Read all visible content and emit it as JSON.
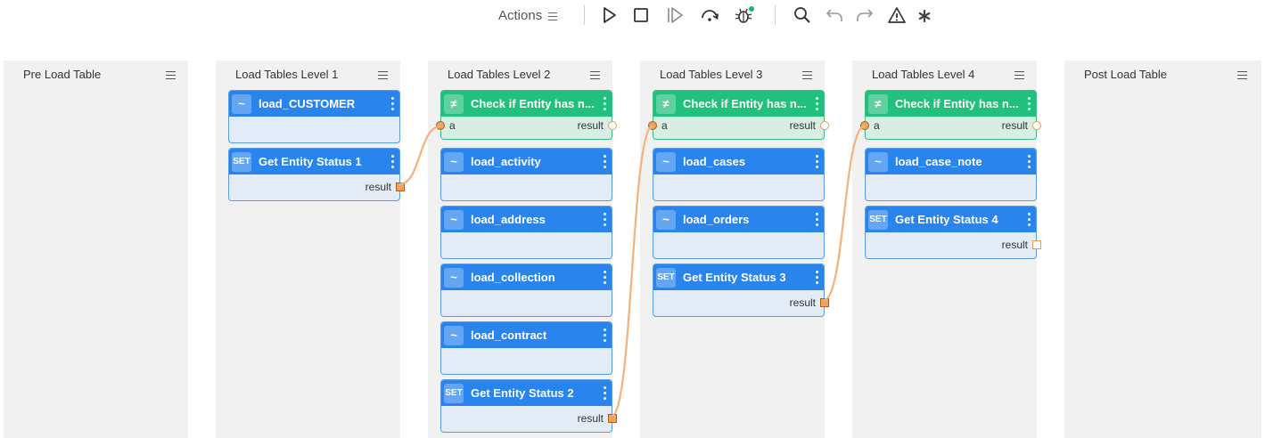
{
  "toolbar": {
    "actions_label": "Actions",
    "buttons": [
      "play-icon",
      "stop-icon",
      "step-icon",
      "step-over-icon",
      "bug-icon",
      "search-icon",
      "undo-icon",
      "redo-icon",
      "warning-icon",
      "asterisk-icon"
    ],
    "accent_color": "#2a84ee",
    "debug_indicator_color": "#1bb36b"
  },
  "columns": [
    {
      "title": "Pre Load Table"
    },
    {
      "title": "Load Tables Level 1"
    },
    {
      "title": "Load Tables Level 2"
    },
    {
      "title": "Load Tables Level 3"
    },
    {
      "title": "Load Tables Level 4"
    },
    {
      "title": "Post Load Table"
    }
  ],
  "cards": {
    "l1_load_customer": {
      "icon": "~",
      "title": "load_CUSTOMER"
    },
    "l1_get_status": {
      "icon": "SET",
      "title": "Get Entity Status 1",
      "output": "result"
    },
    "l2_check": {
      "icon": "≠",
      "title": "Check if Entity has n...",
      "input": "a",
      "output": "result"
    },
    "l2_load_activity": {
      "icon": "~",
      "title": "load_activity"
    },
    "l2_load_address": {
      "icon": "~",
      "title": "load_address"
    },
    "l2_load_collection": {
      "icon": "~",
      "title": "load_collection"
    },
    "l2_load_contract": {
      "icon": "~",
      "title": "load_contract"
    },
    "l2_get_status": {
      "icon": "SET",
      "title": "Get Entity Status 2",
      "output": "result"
    },
    "l3_check": {
      "icon": "≠",
      "title": "Check if Entity has n...",
      "input": "a",
      "output": "result"
    },
    "l3_load_cases": {
      "icon": "~",
      "title": "load_cases"
    },
    "l3_load_orders": {
      "icon": "~",
      "title": "load_orders"
    },
    "l3_get_status": {
      "icon": "SET",
      "title": "Get Entity Status 3",
      "output": "result"
    },
    "l4_check": {
      "icon": "≠",
      "title": "Check if Entity has n...",
      "input": "a",
      "output": "result"
    },
    "l4_load_case_note": {
      "icon": "~",
      "title": "load_case_note"
    },
    "l4_get_status": {
      "icon": "SET",
      "title": "Get Entity Status 4",
      "output": "result"
    }
  },
  "colors": {
    "task_header": "#2a84ee",
    "condition_header": "#22c07d",
    "wire": "#f2b27a",
    "column_bg": "#f1f1f1"
  }
}
